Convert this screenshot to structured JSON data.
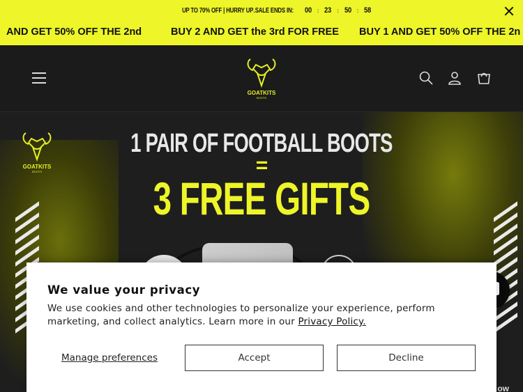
{
  "announcement": {
    "promo_text": "UP TO 70% OFF | HURRY UP․SALE ENDS IN:",
    "timer": [
      "00",
      "23",
      "50",
      "58"
    ],
    "timer_sep": ":",
    "marquee": [
      "AND GET 50% OFF THE 2nd",
      "BUY 2 AND GET the 3rd FOR FREE",
      "BUY 1 AND GET 50% OFF THE 2n"
    ]
  },
  "header": {
    "logo_text": "GOATKITS",
    "logo_sub": "BOOTS"
  },
  "hero": {
    "line1": "1 PAIR OF FOOTBALL BOOTS",
    "equals": "=",
    "line3": "3 FREE GIFTS",
    "logo_text": "GOATKITS",
    "logo_sub": "BOOTS",
    "corner_text": "ow"
  },
  "cookie": {
    "title": "We value your privacy",
    "body": "We use cookies and other technologies to personalize your experience, perform marketing, and collect analytics. Learn more in our",
    "link": "Privacy Policy.",
    "manage": "Manage preferences",
    "accept": "Accept",
    "decline": "Decline"
  },
  "colors": {
    "accent": "#eef528",
    "header_bg": "#1b1b1b"
  },
  "icons": {
    "close": "close-icon",
    "menu": "menu-icon",
    "search": "search-icon",
    "account": "account-icon",
    "cart": "cart-icon",
    "chat": "chat-icon"
  }
}
